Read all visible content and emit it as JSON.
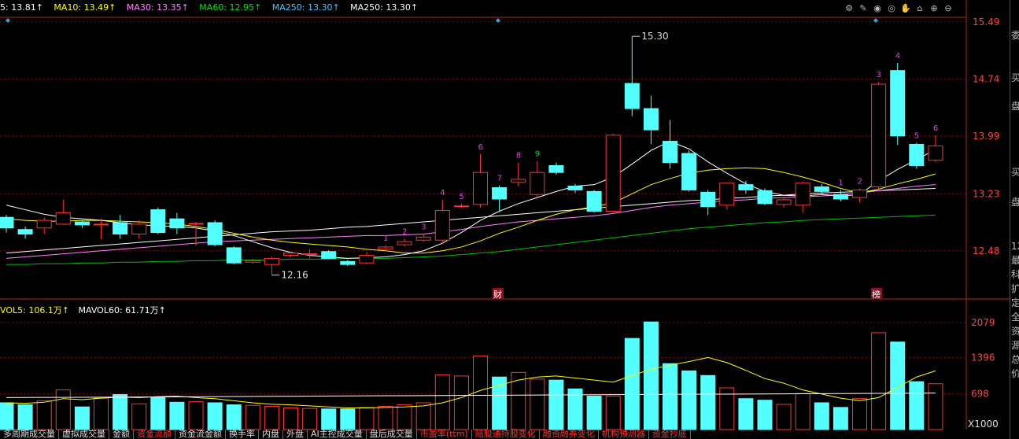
{
  "ma_legend": {
    "ma5": "5: 13.81↑",
    "ma10": "MA10: 13.49↑",
    "ma30": "MA30: 13.35↑",
    "ma60": "MA60: 12.95↑",
    "ma250a": "MA250: 13.30↑",
    "ma250b": "MA250: 13.30↑"
  },
  "vol_legend": {
    "vol5": "VOL5: 106.1万↑",
    "mavol60": "MAVOL60: 61.71万↑"
  },
  "toolbar_icons": [
    "gear-icon",
    "draw-icon",
    "eye-icon",
    "eye-off-icon",
    "hand-icon",
    "lock-icon",
    "zoom-in-icon",
    "zoom-out-icon"
  ],
  "price_axis": [
    "15.49",
    "14.74",
    "13.99",
    "13.23",
    "12.48"
  ],
  "price_axis_cut": "12",
  "vol_axis": [
    "2079",
    "1396",
    "698",
    "X1000"
  ],
  "annotations": {
    "high_label": "15.30",
    "low_label": "12.16",
    "cai_badge": "财",
    "bang_badge": "榜"
  },
  "seq_labels": [
    {
      "t": "1",
      "c": "#e040e0"
    },
    {
      "t": "2",
      "c": "#e040e0"
    },
    {
      "t": "3",
      "c": "#e040e0"
    },
    {
      "t": "4",
      "c": "#e040e0"
    },
    {
      "t": "5",
      "c": "#e040e0"
    },
    {
      "t": "6",
      "c": "#e040e0"
    },
    {
      "t": "7",
      "c": "#e040e0"
    },
    {
      "t": "8",
      "c": "#e040e0"
    },
    {
      "t": "9",
      "c": "#00e000"
    },
    {
      "t": "1",
      "c": "#e040e0"
    },
    {
      "t": "2",
      "c": "#e040e0"
    },
    {
      "t": "3",
      "c": "#e040e0"
    },
    {
      "t": "4",
      "c": "#e040e0"
    },
    {
      "t": "5",
      "c": "#e040e0"
    },
    {
      "t": "6",
      "c": "#e040e0"
    }
  ],
  "right_panel": [
    "委",
    "买",
    "盘",
    "买",
    "盘",
    "12",
    "最",
    "科",
    "扩",
    "定",
    "全",
    "资",
    "源",
    "总",
    "价"
  ],
  "bottom_tabs": [
    {
      "label": "多周期成交量",
      "red": false
    },
    {
      "label": "虚拟成交量",
      "red": false
    },
    {
      "label": "金额",
      "red": false
    },
    {
      "label": "资金流额",
      "red": true
    },
    {
      "label": "资金流金额",
      "red": false
    },
    {
      "label": "换手率",
      "red": false
    },
    {
      "label": "内盘",
      "red": false
    },
    {
      "label": "外盘",
      "red": false
    },
    {
      "label": "AI主控成交量",
      "red": false
    },
    {
      "label": "盘后成交量",
      "red": false
    },
    {
      "label": "市盈率(ttm)",
      "red": true
    },
    {
      "label": "陆股通持股变化",
      "red": true
    },
    {
      "label": "融资融券变化",
      "red": true
    },
    {
      "label": "机构预测器",
      "red": true
    },
    {
      "label": "资金抄底",
      "red": true
    }
  ],
  "colors": {
    "up": "#ff3232",
    "down": "#54ffff",
    "ma5": "#ffffff",
    "ma10": "#ffff00",
    "ma30": "#ff80ff",
    "ma60": "#00c000",
    "ma250": "#ffffff",
    "grid": "#8b0000"
  },
  "chart_data": {
    "type": "candlestick",
    "price_range": [
      11.95,
      15.55
    ],
    "candles": [
      {
        "o": 12.92,
        "c": 12.78,
        "h": 12.95,
        "l": 12.72
      },
      {
        "o": 12.76,
        "c": 12.7,
        "h": 12.8,
        "l": 12.64
      },
      {
        "o": 12.78,
        "c": 12.88,
        "h": 12.92,
        "l": 12.7
      },
      {
        "o": 12.83,
        "c": 12.98,
        "h": 13.15,
        "l": 12.82
      },
      {
        "o": 12.86,
        "c": 12.82,
        "h": 12.88,
        "l": 12.78
      },
      {
        "o": 12.83,
        "c": 12.83,
        "h": 12.9,
        "l": 12.63
      },
      {
        "o": 12.85,
        "c": 12.7,
        "h": 12.95,
        "l": 12.64
      },
      {
        "o": 12.7,
        "c": 12.83,
        "h": 12.88,
        "l": 12.64
      },
      {
        "o": 13.02,
        "c": 12.72,
        "h": 13.05,
        "l": 12.7
      },
      {
        "o": 12.9,
        "c": 12.78,
        "h": 12.98,
        "l": 12.7
      },
      {
        "o": 12.84,
        "c": 12.84,
        "h": 12.86,
        "l": 12.55
      },
      {
        "o": 12.85,
        "c": 12.56,
        "h": 12.88,
        "l": 12.54
      },
      {
        "o": 12.52,
        "c": 12.32,
        "h": 12.54,
        "l": 12.3
      },
      {
        "o": 12.33,
        "c": 12.35,
        "h": 12.37,
        "l": 12.31
      },
      {
        "o": 12.3,
        "c": 12.38,
        "h": 12.4,
        "l": 12.16
      },
      {
        "o": 12.42,
        "c": 12.45,
        "h": 12.47,
        "l": 12.4
      },
      {
        "o": 12.44,
        "c": 12.44,
        "h": 12.5,
        "l": 12.38
      },
      {
        "o": 12.47,
        "c": 12.38,
        "h": 12.49,
        "l": 12.37
      },
      {
        "o": 12.34,
        "c": 12.3,
        "h": 12.36,
        "l": 12.28
      },
      {
        "o": 12.32,
        "c": 12.42,
        "h": 12.46,
        "l": 12.3
      },
      {
        "o": 12.5,
        "c": 12.53,
        "h": 12.55,
        "l": 12.48
      },
      {
        "o": 12.56,
        "c": 12.6,
        "h": 12.64,
        "l": 12.54
      },
      {
        "o": 12.62,
        "c": 12.66,
        "h": 12.7,
        "l": 12.6
      },
      {
        "o": 12.62,
        "c": 13.01,
        "h": 13.15,
        "l": 12.58
      },
      {
        "o": 13.07,
        "c": 13.07,
        "h": 13.1,
        "l": 13.04
      },
      {
        "o": 13.09,
        "c": 13.51,
        "h": 13.75,
        "l": 13.05
      },
      {
        "o": 13.31,
        "c": 13.16,
        "h": 13.34,
        "l": 13.0
      },
      {
        "o": 13.38,
        "c": 13.42,
        "h": 13.64,
        "l": 13.33
      },
      {
        "o": 13.22,
        "c": 13.51,
        "h": 13.66,
        "l": 13.18
      },
      {
        "o": 13.6,
        "c": 13.51,
        "h": 13.64,
        "l": 13.48
      },
      {
        "o": 13.33,
        "c": 13.28,
        "h": 13.36,
        "l": 13.24
      },
      {
        "o": 13.26,
        "c": 13.0,
        "h": 13.28,
        "l": 12.98
      },
      {
        "o": 13.0,
        "c": 14.0,
        "h": 14.02,
        "l": 12.98
      },
      {
        "o": 14.68,
        "c": 14.35,
        "h": 15.3,
        "l": 14.25
      },
      {
        "o": 14.35,
        "c": 14.07,
        "h": 14.52,
        "l": 13.88
      },
      {
        "o": 13.92,
        "c": 13.64,
        "h": 14.2,
        "l": 13.56
      },
      {
        "o": 13.76,
        "c": 13.28,
        "h": 13.8,
        "l": 13.26
      },
      {
        "o": 13.25,
        "c": 13.06,
        "h": 13.28,
        "l": 12.95
      },
      {
        "o": 13.08,
        "c": 13.37,
        "h": 13.38,
        "l": 13.02
      },
      {
        "o": 13.35,
        "c": 13.28,
        "h": 13.4,
        "l": 13.23
      },
      {
        "o": 13.27,
        "c": 13.1,
        "h": 13.3,
        "l": 13.08
      },
      {
        "o": 13.09,
        "c": 13.15,
        "h": 13.18,
        "l": 13.05
      },
      {
        "o": 13.08,
        "c": 13.37,
        "h": 13.39,
        "l": 12.98
      },
      {
        "o": 13.32,
        "c": 13.26,
        "h": 13.36,
        "l": 13.22
      },
      {
        "o": 13.22,
        "c": 13.16,
        "h": 13.28,
        "l": 13.13
      },
      {
        "o": 13.18,
        "c": 13.28,
        "h": 13.3,
        "l": 13.12
      },
      {
        "o": 13.32,
        "c": 14.67,
        "h": 14.7,
        "l": 13.28
      },
      {
        "o": 14.85,
        "c": 13.99,
        "h": 14.95,
        "l": 13.87
      },
      {
        "o": 13.88,
        "c": 13.6,
        "h": 13.9,
        "l": 13.56
      },
      {
        "o": 13.67,
        "c": 13.86,
        "h": 14.0,
        "l": 13.65
      }
    ],
    "ma5": [
      13.08,
      13.02,
      12.96,
      12.92,
      12.9,
      12.88,
      12.85,
      12.82,
      12.81,
      12.8,
      12.78,
      12.74,
      12.68,
      12.6,
      12.52,
      12.46,
      12.42,
      12.4,
      12.38,
      12.39,
      12.4,
      12.43,
      12.48,
      12.58,
      12.72,
      12.88,
      13.0,
      13.1,
      13.18,
      13.26,
      13.33,
      13.35,
      13.45,
      13.62,
      13.8,
      13.92,
      13.82,
      13.65,
      13.5,
      13.36,
      13.26,
      13.21,
      13.2,
      13.22,
      13.2,
      13.22,
      13.4,
      13.55,
      13.68,
      13.81
    ],
    "ma10": [
      12.9,
      12.88,
      12.87,
      12.87,
      12.88,
      12.88,
      12.87,
      12.86,
      12.85,
      12.83,
      12.8,
      12.76,
      12.71,
      12.66,
      12.62,
      12.59,
      12.57,
      12.55,
      12.53,
      12.5,
      12.48,
      12.45,
      12.45,
      12.48,
      12.53,
      12.61,
      12.71,
      12.79,
      12.88,
      12.96,
      13.02,
      13.06,
      13.11,
      13.23,
      13.35,
      13.43,
      13.5,
      13.54,
      13.56,
      13.57,
      13.56,
      13.51,
      13.45,
      13.38,
      13.3,
      13.24,
      13.29,
      13.36,
      13.42,
      13.49
    ],
    "ma30": [
      12.38,
      12.4,
      12.42,
      12.44,
      12.46,
      12.48,
      12.5,
      12.52,
      12.54,
      12.56,
      12.58,
      12.6,
      12.61,
      12.62,
      12.63,
      12.64,
      12.65,
      12.66,
      12.67,
      12.68,
      12.68,
      12.69,
      12.7,
      12.73,
      12.76,
      12.8,
      12.83,
      12.86,
      12.88,
      12.9,
      12.92,
      12.94,
      12.97,
      13.01,
      13.05,
      13.08,
      13.1,
      13.12,
      13.14,
      13.15,
      13.17,
      13.18,
      13.19,
      13.2,
      13.22,
      13.24,
      13.27,
      13.3,
      13.33,
      13.35
    ],
    "ma60": [
      12.3,
      12.3,
      12.31,
      12.31,
      12.32,
      12.32,
      12.33,
      12.33,
      12.34,
      12.34,
      12.35,
      12.35,
      12.36,
      12.36,
      12.36,
      12.37,
      12.37,
      12.37,
      12.38,
      12.38,
      12.38,
      12.39,
      12.4,
      12.41,
      12.43,
      12.45,
      12.47,
      12.5,
      12.53,
      12.56,
      12.59,
      12.62,
      12.65,
      12.68,
      12.71,
      12.74,
      12.77,
      12.79,
      12.81,
      12.83,
      12.85,
      12.86,
      12.88,
      12.89,
      12.9,
      12.91,
      12.92,
      12.93,
      12.94,
      12.95
    ],
    "ma250": [
      12.45,
      12.47,
      12.49,
      12.51,
      12.53,
      12.55,
      12.57,
      12.59,
      12.61,
      12.63,
      12.65,
      12.67,
      12.69,
      12.71,
      12.73,
      12.74,
      12.75,
      12.77,
      12.79,
      12.8,
      12.82,
      12.84,
      12.86,
      12.88,
      12.9,
      12.92,
      12.94,
      12.96,
      12.98,
      13.0,
      13.02,
      13.04,
      13.06,
      13.08,
      13.1,
      13.12,
      13.14,
      13.15,
      13.17,
      13.18,
      13.2,
      13.21,
      13.23,
      13.24,
      13.25,
      13.26,
      13.27,
      13.28,
      13.29,
      13.3
    ],
    "volume_range": [
      0,
      2200
    ],
    "volume": [
      520,
      480,
      560,
      770,
      440,
      610,
      680,
      500,
      630,
      530,
      540,
      520,
      480,
      470,
      450,
      420,
      410,
      400,
      400,
      430,
      450,
      480,
      520,
      1060,
      1040,
      1430,
      1020,
      1110,
      980,
      960,
      790,
      650,
      650,
      1770,
      2090,
      1280,
      1140,
      1050,
      810,
      600,
      570,
      490,
      700,
      520,
      430,
      600,
      1880,
      1700,
      930,
      890
    ],
    "vol_ma": [
      520,
      510,
      530,
      600,
      580,
      610,
      630,
      620,
      640,
      650,
      620,
      600,
      560,
      520,
      490,
      480,
      460,
      440,
      420,
      420,
      430,
      440,
      460,
      520,
      620,
      760,
      860,
      960,
      1020,
      1040,
      1000,
      960,
      920,
      1050,
      1170,
      1250,
      1320,
      1400,
      1300,
      1150,
      990,
      900,
      770,
      690,
      610,
      560,
      620,
      820,
      1020,
      1140
    ]
  }
}
